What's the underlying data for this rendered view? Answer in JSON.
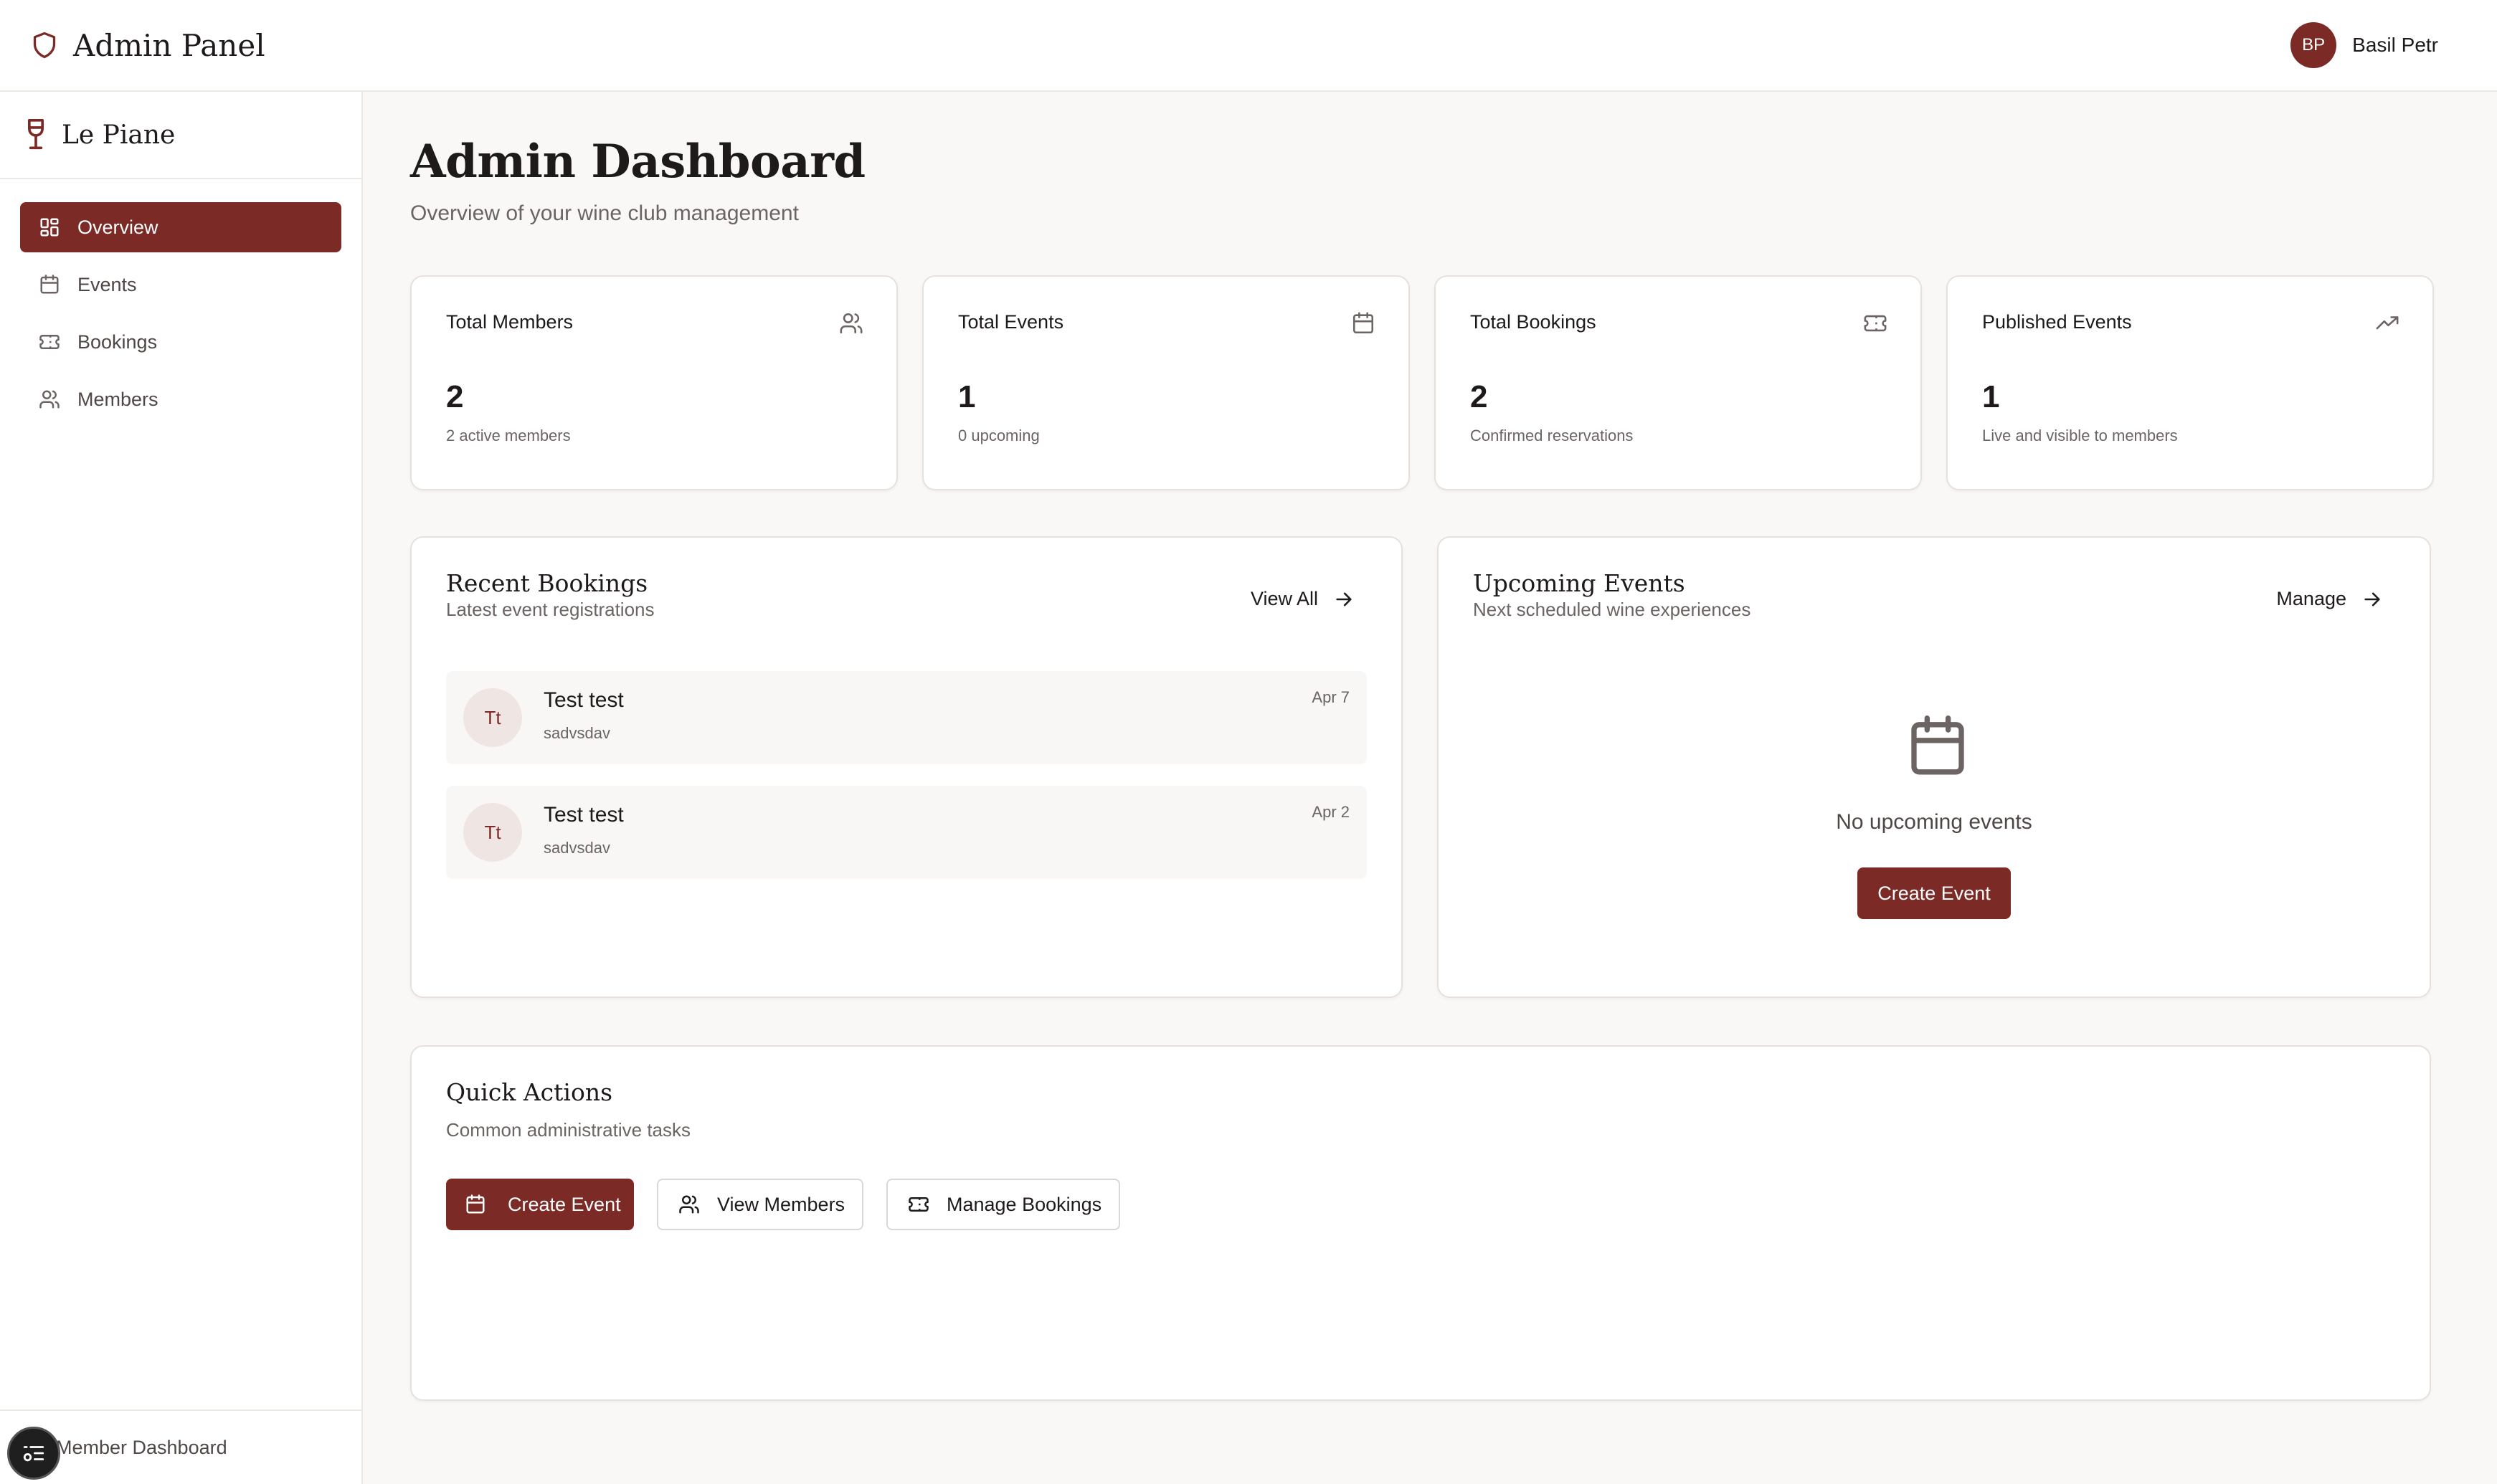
{
  "header": {
    "title": "Admin Panel",
    "user_initials": "BP",
    "user_name": "Basil Petr"
  },
  "sidebar": {
    "brand": "Le Piane",
    "items": [
      {
        "label": "Overview",
        "icon": "layout-grid-icon",
        "active": true
      },
      {
        "label": "Events",
        "icon": "calendar-icon"
      },
      {
        "label": "Bookings",
        "icon": "ticket-icon"
      },
      {
        "label": "Members",
        "icon": "users-icon"
      }
    ],
    "footer_link": "Member Dashboard"
  },
  "main": {
    "title": "Admin Dashboard",
    "subtitle": "Overview of your wine club management"
  },
  "stats": [
    {
      "label": "Total Members",
      "value": "2",
      "note": "2 active members",
      "icon": "users-icon"
    },
    {
      "label": "Total Events",
      "value": "1",
      "note": "0 upcoming",
      "icon": "calendar-icon"
    },
    {
      "label": "Total Bookings",
      "value": "2",
      "note": "Confirmed reservations",
      "icon": "ticket-icon"
    },
    {
      "label": "Published Events",
      "value": "1",
      "note": "Live and visible to members",
      "icon": "trending-up-icon"
    }
  ],
  "recent_bookings": {
    "title": "Recent Bookings",
    "subtitle": "Latest event registrations",
    "link": "View All",
    "items": [
      {
        "initials": "Tt",
        "name": "Test test",
        "username": "sadvsdav",
        "date": "Apr 7"
      },
      {
        "initials": "Tt",
        "name": "Test test",
        "username": "sadvsdav",
        "date": "Apr 2"
      }
    ]
  },
  "upcoming_events": {
    "title": "Upcoming Events",
    "subtitle": "Next scheduled wine experiences",
    "link": "Manage",
    "empty_text": "No upcoming events",
    "button": "Create Event"
  },
  "quick_actions": {
    "title": "Quick Actions",
    "subtitle": "Common administrative tasks",
    "buttons": [
      {
        "label": "Create Event",
        "icon": "calendar-icon",
        "primary": true
      },
      {
        "label": "View Members",
        "icon": "users-icon"
      },
      {
        "label": "Manage Bookings",
        "icon": "ticket-icon"
      }
    ]
  },
  "colors": {
    "accent": "#7b2a26",
    "background": "#f9f8f6",
    "text": "#1e1a1a",
    "muted": "#6b6463"
  }
}
